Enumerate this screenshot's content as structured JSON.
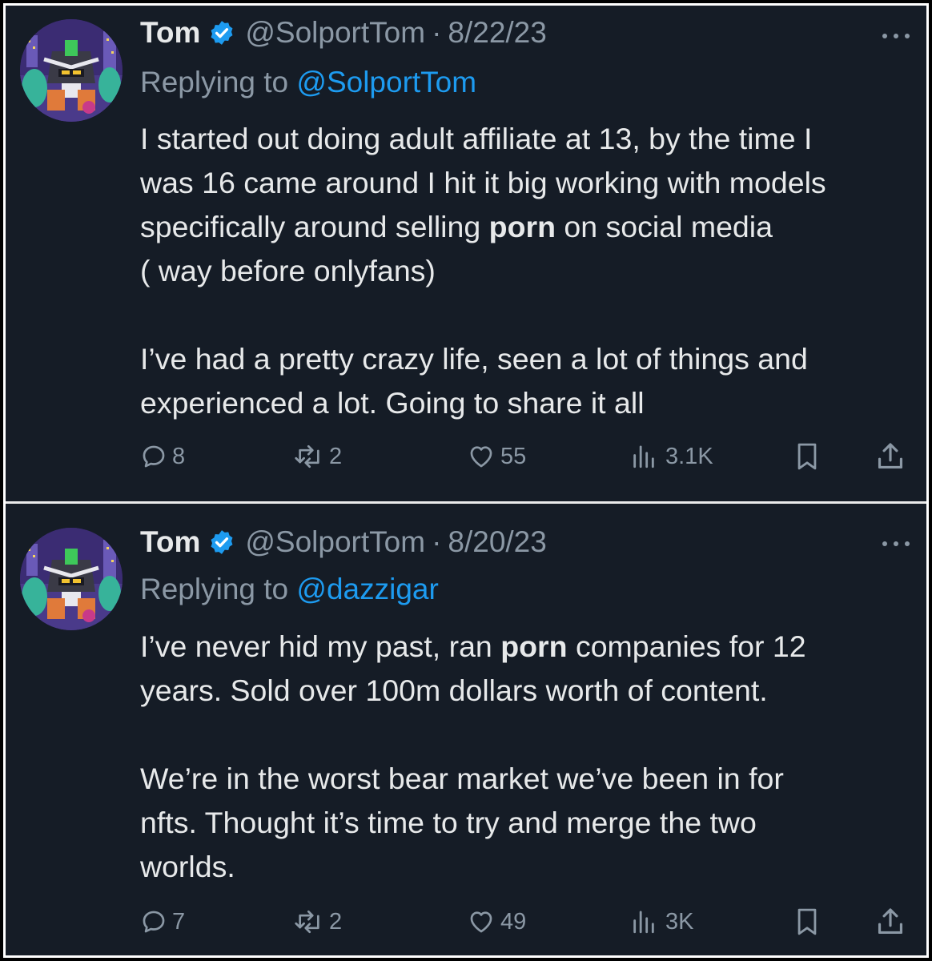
{
  "tweets": [
    {
      "author": {
        "name": "Tom",
        "handle": "@SolportTom",
        "verified": true
      },
      "separator": "·",
      "date": "8/22/23",
      "reply_prefix": "Replying to",
      "reply_to": "@SolportTom",
      "paragraphs": [
        {
          "lines": [
            {
              "pre": "I started out doing adult affiliate at 13, by the time I",
              "bold": "",
              "post": ""
            },
            {
              "pre": "was 16 came around I hit it big working with models",
              "bold": "",
              "post": ""
            },
            {
              "pre": "specifically around selling ",
              "bold": "porn",
              "post": " on social media"
            },
            {
              "pre": "( way before onlyfans)",
              "bold": "",
              "post": ""
            }
          ]
        },
        {
          "lines": [
            {
              "pre": "I’ve had a pretty crazy life, seen a lot of things and",
              "bold": "",
              "post": ""
            },
            {
              "pre": "experienced a lot. Going to share it all",
              "bold": "",
              "post": ""
            }
          ]
        }
      ],
      "stats": {
        "replies": "8",
        "reposts": "2",
        "likes": "55",
        "views": "3.1K"
      }
    },
    {
      "author": {
        "name": "Tom",
        "handle": "@SolportTom",
        "verified": true
      },
      "separator": "·",
      "date": "8/20/23",
      "reply_prefix": "Replying to",
      "reply_to": "@dazzigar",
      "paragraphs": [
        {
          "lines": [
            {
              "pre": "I’ve never hid my past, ran ",
              "bold": "porn",
              "post": " companies for 12"
            },
            {
              "pre": "years. Sold over 100m dollars worth of content.",
              "bold": "",
              "post": ""
            }
          ]
        },
        {
          "lines": [
            {
              "pre": "We’re in the worst bear market we’ve been in for",
              "bold": "",
              "post": ""
            },
            {
              "pre": "nfts. Thought it’s time to try and merge the two",
              "bold": "",
              "post": ""
            },
            {
              "pre": "worlds.",
              "bold": "",
              "post": ""
            }
          ]
        }
      ],
      "stats": {
        "replies": "7",
        "reposts": "2",
        "likes": "49",
        "views": "3K"
      }
    }
  ],
  "icons": {
    "verified": "verified-badge-icon",
    "more": "more-options-icon",
    "reply": "reply-icon",
    "repost": "repost-icon",
    "like": "heart-icon",
    "views": "views-icon",
    "bookmark": "bookmark-icon",
    "share": "share-icon"
  },
  "colors": {
    "background": "#151c26",
    "text": "#e7e9ea",
    "secondary": "#8b98a5",
    "accent": "#1d9bf0"
  }
}
